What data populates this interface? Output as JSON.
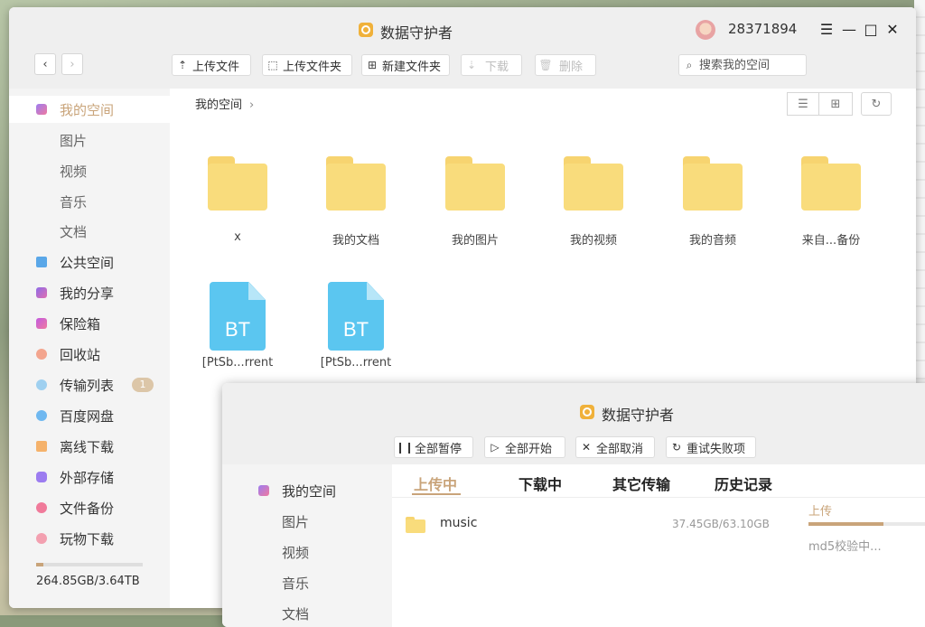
{
  "main_window": {
    "title": "数据守护者",
    "user_id": "28371894",
    "toolbar": {
      "back": "‹",
      "forward": "›",
      "upload_file": "上传文件",
      "upload_folder": "上传文件夹",
      "new_folder": "新建文件夹",
      "download": "下载",
      "delete": "删除",
      "search_placeholder": "搜索我的空间"
    },
    "sidebar": {
      "items": [
        {
          "label": "我的空间",
          "icon": "my-space-icon"
        },
        {
          "label": "图片"
        },
        {
          "label": "视频"
        },
        {
          "label": "音乐"
        },
        {
          "label": "文档"
        },
        {
          "label": "公共空间",
          "icon": "public-space-icon"
        },
        {
          "label": "我的分享",
          "icon": "share-icon"
        },
        {
          "label": "保险箱",
          "icon": "safe-icon"
        },
        {
          "label": "回收站",
          "icon": "trash-icon"
        },
        {
          "label": "传输列表",
          "icon": "transfer-icon",
          "badge": "1"
        },
        {
          "label": "百度网盘",
          "icon": "baidu-cloud-icon"
        },
        {
          "label": "离线下载",
          "icon": "offline-download-icon"
        },
        {
          "label": "外部存储",
          "icon": "external-storage-icon"
        },
        {
          "label": "文件备份",
          "icon": "backup-icon"
        },
        {
          "label": "玩物下载",
          "icon": "wanwu-download-icon"
        }
      ],
      "storage_text": "264.85GB/3.64TB",
      "storage_used_fraction": 0.07
    },
    "breadcrumb": "我的空间",
    "files": [
      {
        "name": "x",
        "type": "folder"
      },
      {
        "name": "我的文档",
        "type": "folder"
      },
      {
        "name": "我的图片",
        "type": "folder"
      },
      {
        "name": "我的视频",
        "type": "folder"
      },
      {
        "name": "我的音频",
        "type": "folder"
      },
      {
        "name": "来自...备份",
        "type": "folder"
      },
      {
        "name": "[PtSb...rrent",
        "type": "bt",
        "badge": "BT"
      },
      {
        "name": "[PtSb...rrent",
        "type": "bt",
        "badge": "BT"
      }
    ]
  },
  "transfer_window": {
    "title": "数据守护者",
    "buttons": {
      "pause_all": "全部暂停",
      "start_all": "全部开始",
      "cancel_all": "全部取消",
      "retry_failed": "重试失败项"
    },
    "sidebar": [
      {
        "label": "我的空间",
        "icon": "my-space-icon"
      },
      {
        "label": "图片"
      },
      {
        "label": "视频"
      },
      {
        "label": "音乐"
      },
      {
        "label": "文档"
      }
    ],
    "tabs": [
      "上传中",
      "下载中",
      "其它传输",
      "历史记录"
    ],
    "tasks": [
      {
        "name": "music",
        "size": "37.45GB/63.10GB",
        "direction": "上传",
        "progress_fraction": 0.59,
        "status": "md5校验中..."
      }
    ]
  },
  "colors": {
    "accent": "#c9a47a",
    "folder": "#f9dc7c",
    "bt_file": "#5bc6f0"
  }
}
